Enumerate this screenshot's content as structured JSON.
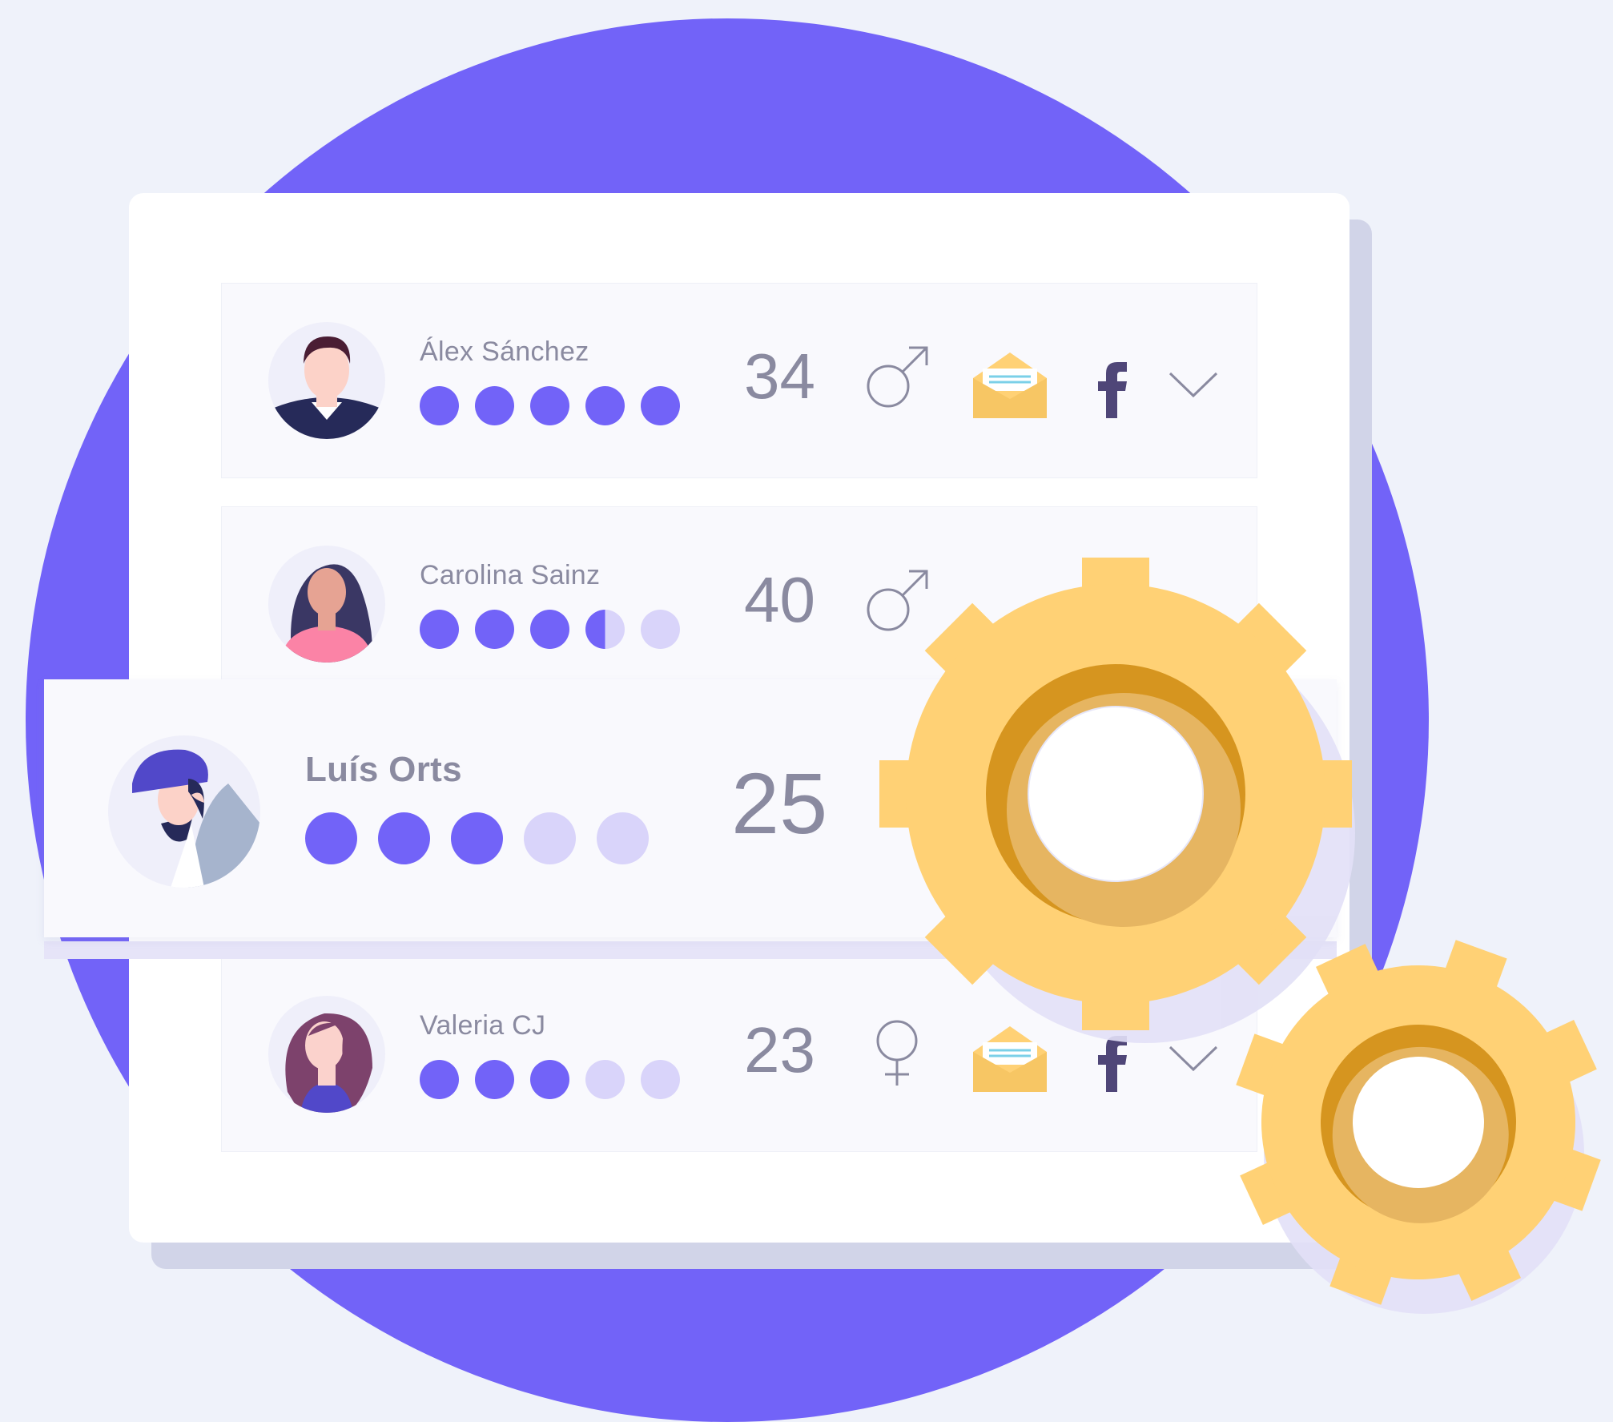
{
  "colors": {
    "accent": "#7263f8",
    "dot_empty": "#d9d4fa",
    "background_circle": "#7263f8",
    "gear": "#ffd175",
    "text": "#8a8aa0"
  },
  "users": [
    {
      "name": "Álex Sánchez",
      "age": "34",
      "gender": "male-symbol-icon",
      "rating": 5,
      "email_icon": "envelope-icon",
      "social_icon": "facebook-icon"
    },
    {
      "name": "Carolina Sainz",
      "age": "40",
      "gender": "male-symbol-icon",
      "rating": 3.5
    },
    {
      "name": "Luís Orts",
      "age": "25",
      "rating": 3
    },
    {
      "name": "Valeria CJ",
      "age": "23",
      "gender": "female-symbol-icon",
      "rating": 3,
      "email_icon": "envelope-icon",
      "social_icon": "facebook-icon"
    }
  ],
  "decoration": {
    "icons": [
      "gear-icon-large",
      "gear-icon-small"
    ]
  }
}
